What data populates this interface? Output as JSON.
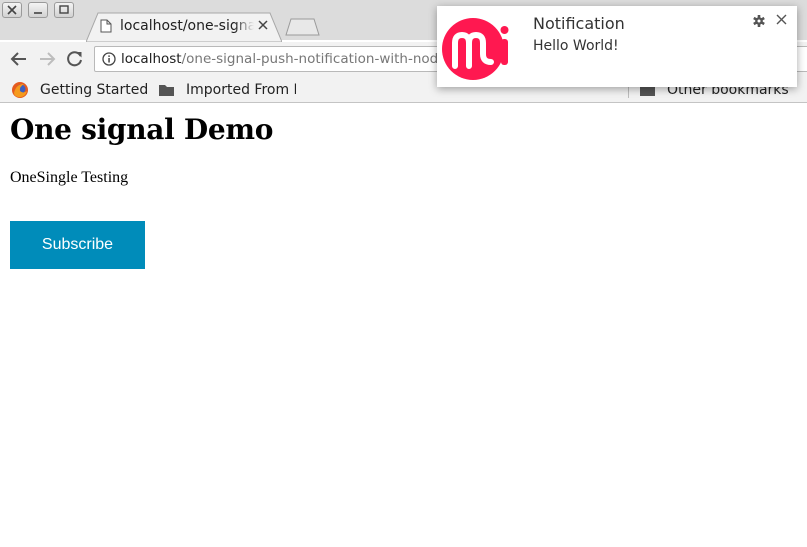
{
  "browser": {
    "tab": {
      "title": "localhost/one-signal-push-notification-with-nodejs"
    },
    "address_bar": {
      "host": "localhost",
      "path": "/one-signal-push-notification-with-nodejs"
    },
    "bookmarks": [
      {
        "label": "Getting Started",
        "icon": "firefox-icon"
      },
      {
        "label": "Imported From Firefox",
        "icon": "folder-icon"
      }
    ],
    "other_bookmarks": {
      "label": "Other bookmarks",
      "icon": "folder-icon"
    }
  },
  "page": {
    "heading": "One signal Demo",
    "text": "OneSingle Testing",
    "subscribe_label": "Subscribe"
  },
  "notification": {
    "title": "Notification",
    "body": "Hello World!",
    "logo_text": "mi"
  },
  "colors": {
    "subscribe_button": "#008cba",
    "logo_accent": "#ff1850",
    "chrome": "#f2f2f2"
  }
}
